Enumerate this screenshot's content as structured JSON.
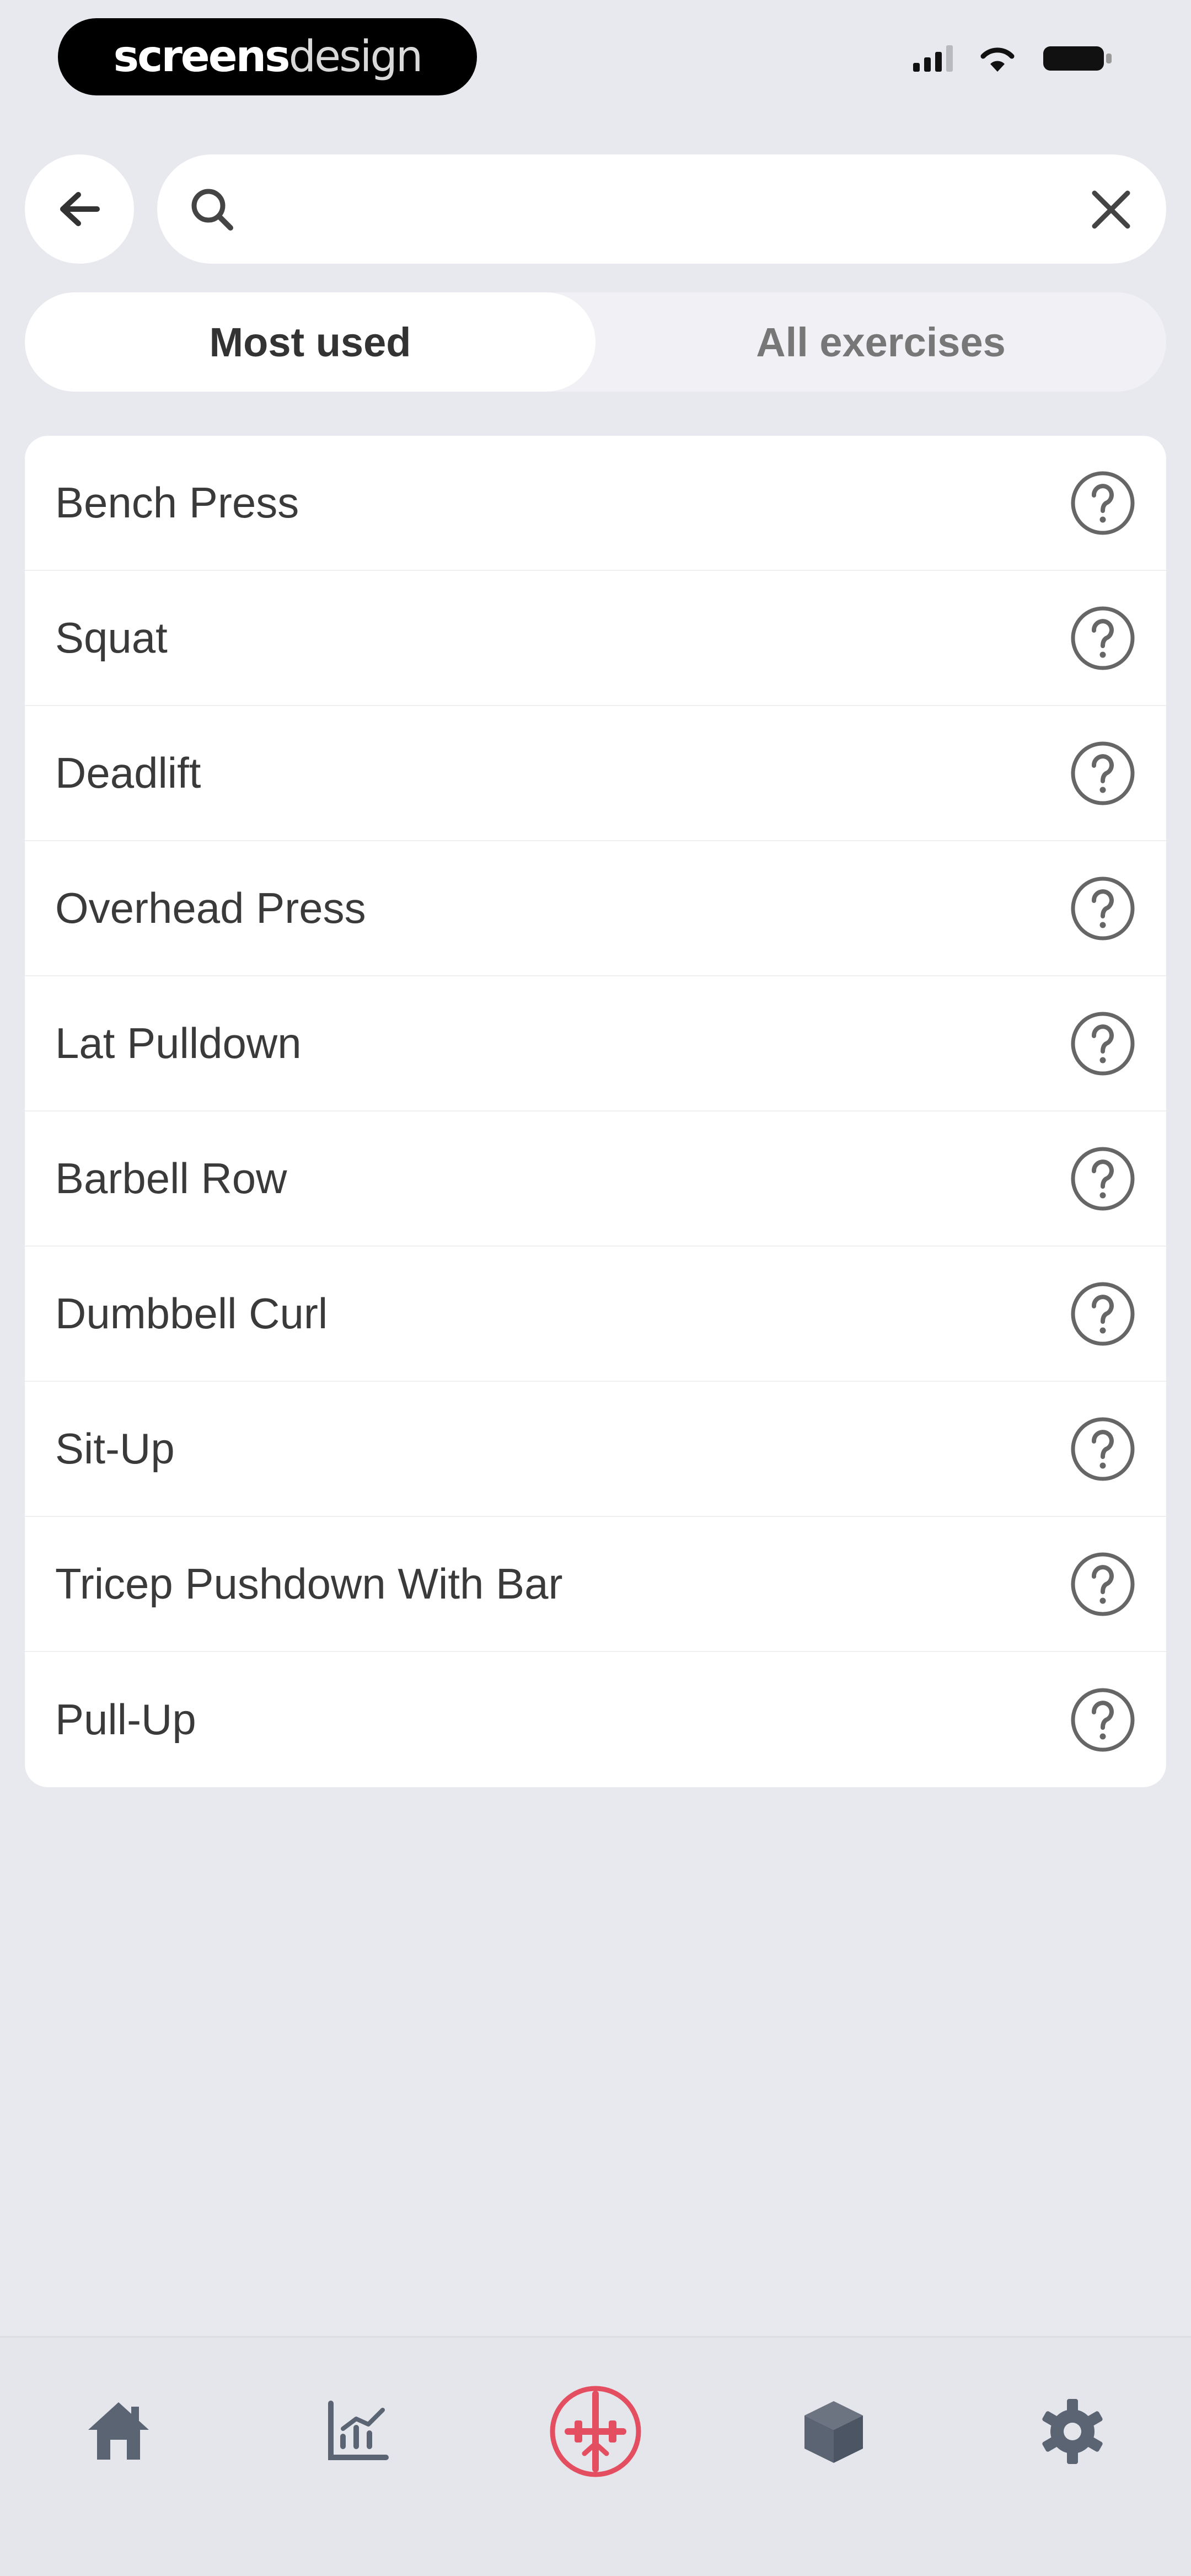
{
  "brand": {
    "bold": "screens",
    "light": "design"
  },
  "search": {
    "value": "",
    "placeholder": ""
  },
  "tabs": [
    {
      "label": "Most used",
      "active": true
    },
    {
      "label": "All exercises",
      "active": false
    }
  ],
  "exercises": [
    {
      "label": "Bench Press"
    },
    {
      "label": "Squat"
    },
    {
      "label": "Deadlift"
    },
    {
      "label": "Overhead Press"
    },
    {
      "label": "Lat Pulldown"
    },
    {
      "label": "Barbell Row"
    },
    {
      "label": "Dumbbell Curl"
    },
    {
      "label": "Sit-Up"
    },
    {
      "label": "Tricep Pushdown With Bar"
    },
    {
      "label": "Pull-Up"
    }
  ],
  "bottom_nav": [
    {
      "icon": "home-icon",
      "active": false
    },
    {
      "icon": "chart-icon",
      "active": false
    },
    {
      "icon": "workout-icon",
      "active": true
    },
    {
      "icon": "cube-icon",
      "active": false
    },
    {
      "icon": "gear-icon",
      "active": false
    }
  ],
  "colors": {
    "accent": "#e34f60",
    "background": "#e8e9ee",
    "card": "#ffffff",
    "icon": "#5b6472"
  }
}
